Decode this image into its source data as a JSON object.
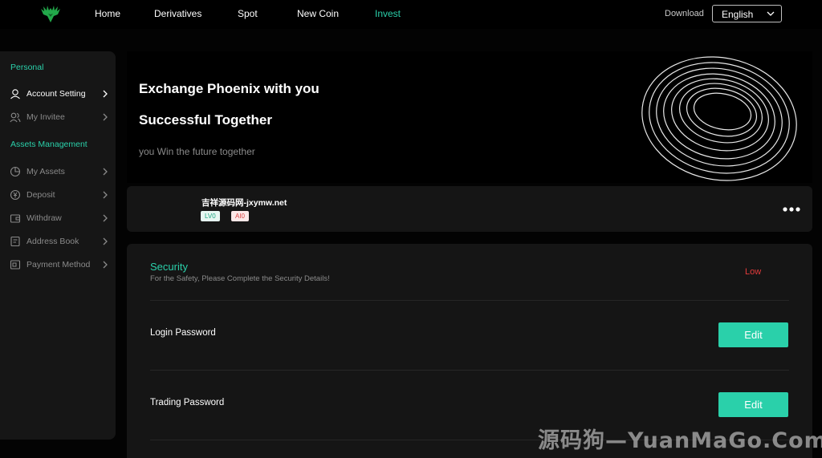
{
  "nav": {
    "items": [
      {
        "label": "Home",
        "active": false
      },
      {
        "label": "Derivatives",
        "active": false
      },
      {
        "label": "Spot",
        "active": false
      },
      {
        "label": "New Coin",
        "active": false
      },
      {
        "label": "Invest",
        "active": true
      }
    ],
    "download_label": "Download",
    "language_selected": "English"
  },
  "sidebar": {
    "group_personal": "Personal",
    "group_assets": "Assets Management",
    "items": [
      {
        "label": "Account Setting",
        "icon": "user-icon",
        "active": true
      },
      {
        "label": "My Invitee",
        "icon": "users-icon",
        "active": false
      },
      {
        "label": "My Assets",
        "icon": "pie-chart-icon",
        "active": false
      },
      {
        "label": "Deposit",
        "icon": "coin-icon",
        "active": false
      },
      {
        "label": "Withdraw",
        "icon": "wallet-icon",
        "active": false
      },
      {
        "label": "Address Book",
        "icon": "book-icon",
        "active": false
      },
      {
        "label": "Payment Method",
        "icon": "card-icon",
        "active": false
      }
    ]
  },
  "hero": {
    "title_line1": "Exchange Phoenix with you",
    "title_line2": "Successful Together",
    "subtitle": "you Win the future together"
  },
  "user": {
    "name": "吉祥源码网-jxymw.net",
    "level_badge": "LV0",
    "ai_badge": "AI0"
  },
  "security": {
    "title": "Security",
    "subtitle": "For the Safety, Please Complete the Security Details!",
    "level": "Low",
    "rows": [
      {
        "label": "Login Password",
        "button": "Edit"
      },
      {
        "label": "Trading Password",
        "button": "Edit"
      }
    ]
  },
  "watermark": "源码狗—YuanMaGo.Com",
  "colors": {
    "accent": "#2ad0aa",
    "danger": "#e53b3b",
    "panel": "#151515",
    "background": "#000000"
  }
}
